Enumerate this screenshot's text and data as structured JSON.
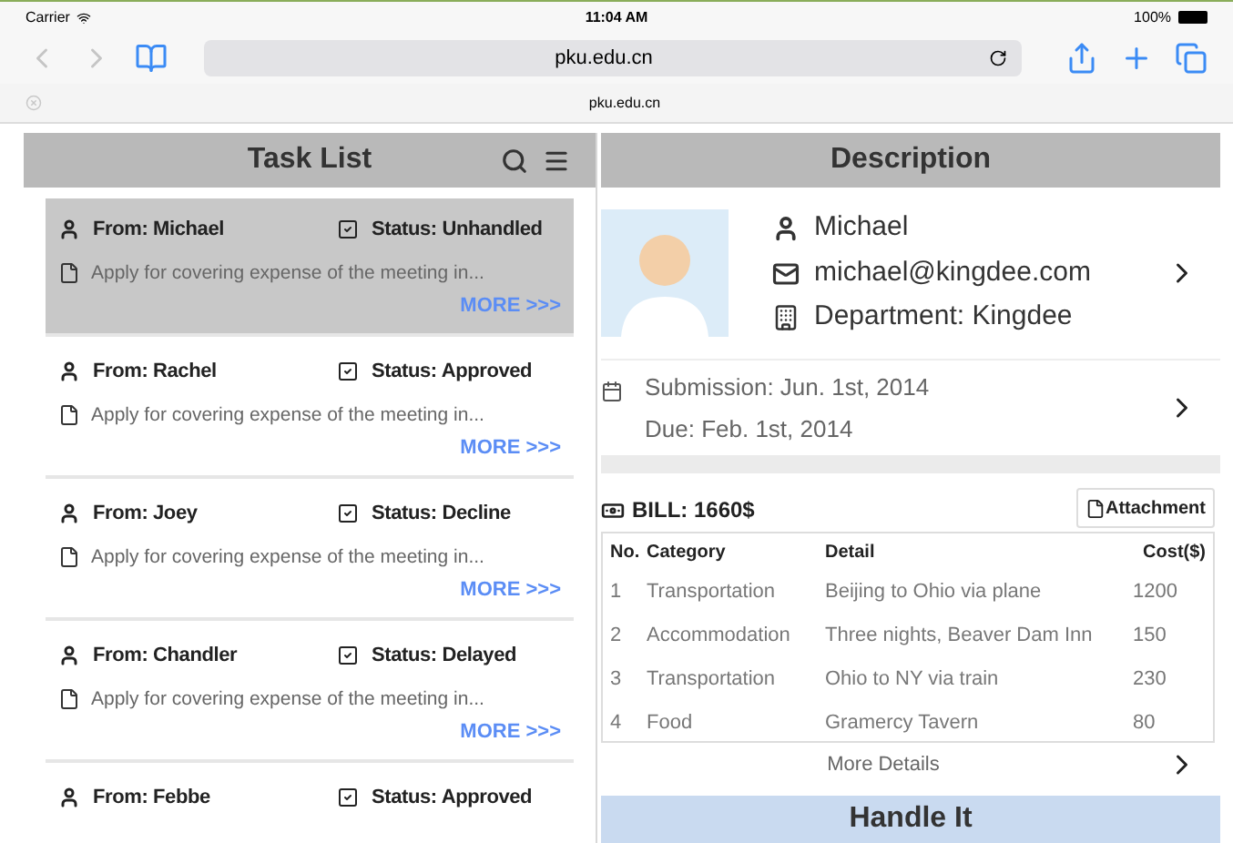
{
  "status_bar": {
    "carrier": "Carrier",
    "time": "11:04 AM",
    "battery": "100%"
  },
  "browser": {
    "url": "pku.edu.cn",
    "tab_title": "pku.edu.cn"
  },
  "task_list": {
    "title": "Task List",
    "items": [
      {
        "from": "From: Michael",
        "status": "Status: Unhandled",
        "summary": "Apply for covering expense of the meeting in...",
        "more": "MORE >>>",
        "selected": true
      },
      {
        "from": "From: Rachel",
        "status": "Status: Approved",
        "summary": "Apply for covering expense of the meeting in...",
        "more": "MORE >>>",
        "selected": false
      },
      {
        "from": "From: Joey",
        "status": "Status: Decline",
        "summary": "Apply for covering expense of the meeting in...",
        "more": "MORE >>>",
        "selected": false
      },
      {
        "from": "From: Chandler",
        "status": "Status: Delayed",
        "summary": "Apply for covering expense of the meeting in...",
        "more": "MORE >>>",
        "selected": false
      },
      {
        "from": "From: Febbe",
        "status": "Status: Approved",
        "selected": false
      }
    ]
  },
  "description": {
    "title": "Description",
    "name": "Michael",
    "email": "michael@kingdee.com",
    "department": "Department: Kingdee",
    "submission": "Submission: Jun. 1st, 2014",
    "due": "Due: Feb. 1st, 2014",
    "bill": "BILL: 1660$",
    "attachment": "Attachment",
    "table": {
      "columns": [
        "No.",
        "Category",
        "Detail",
        "Cost($)"
      ],
      "rows": [
        [
          "1",
          "Transportation",
          "Beijing to Ohio via plane",
          "1200"
        ],
        [
          "2",
          "Accommodation",
          "Three nights, Beaver Dam Inn",
          "150"
        ],
        [
          "3",
          "Transportation",
          "Ohio to NY via train",
          "230"
        ],
        [
          "4",
          "Food",
          "Gramercy Tavern",
          "80"
        ]
      ]
    },
    "more_details": "More Details",
    "action": "Handle It"
  }
}
